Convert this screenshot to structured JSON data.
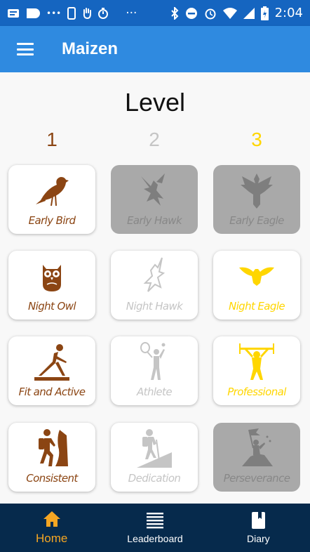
{
  "status_bar": {
    "time": "2:04",
    "dots": "•••",
    "ellipsis": "···"
  },
  "app_bar": {
    "title": "Maizen"
  },
  "level_heading": "Level",
  "levels": [
    {
      "label": "1",
      "color": "#8B4513"
    },
    {
      "label": "2",
      "color": "#C5C5C5"
    },
    {
      "label": "3",
      "color": "#FFD600"
    }
  ],
  "badges": [
    {
      "label": "Early Bird",
      "icon": "bird-icon",
      "state": "earned-level-1"
    },
    {
      "label": "Early Hawk",
      "icon": "hawk-icon",
      "state": "locked"
    },
    {
      "label": "Early Eagle",
      "icon": "eagle-icon",
      "state": "locked"
    },
    {
      "label": "Night Owl",
      "icon": "owl-icon",
      "state": "earned-level-1"
    },
    {
      "label": "Night Hawk",
      "icon": "hawk-icon",
      "state": "not-earned"
    },
    {
      "label": "Night Eagle",
      "icon": "eagle-icon",
      "state": "earned-level-3"
    },
    {
      "label": "Fit and Active",
      "icon": "yoga-icon",
      "state": "earned-level-1"
    },
    {
      "label": "Athlete",
      "icon": "tennis-player-icon",
      "state": "not-earned"
    },
    {
      "label": "Professional",
      "icon": "weightlifter-icon",
      "state": "earned-level-3"
    },
    {
      "label": "Consistent",
      "icon": "climber-icon",
      "state": "earned-level-1"
    },
    {
      "label": "Dedication",
      "icon": "hiker-icon",
      "state": "not-earned"
    },
    {
      "label": "Perseverance",
      "icon": "summit-flag-icon",
      "state": "locked"
    }
  ],
  "bottom_nav": [
    {
      "label": "Home",
      "icon": "home-icon",
      "active": true
    },
    {
      "label": "Leaderboard",
      "icon": "list-icon",
      "active": false
    },
    {
      "label": "Diary",
      "icon": "book-icon",
      "active": false
    }
  ],
  "colors": {
    "status_bar": "#1565C0",
    "app_bar": "#2F8AE0",
    "bottom_nav": "#062A4C",
    "active_nav": "#F5A623",
    "level_1": "#8B4513",
    "level_2": "#C5C5C5",
    "level_3": "#FFD600",
    "locked_card": "#A9A9A9"
  }
}
